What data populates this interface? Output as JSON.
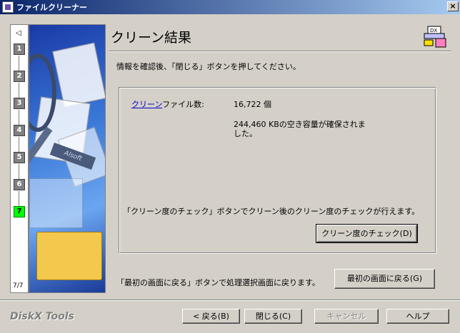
{
  "window": {
    "title": "ファイルクリーナー",
    "close_glyph": "×"
  },
  "steps": {
    "arrow": "◁",
    "items": [
      "1",
      "2",
      "3",
      "4",
      "5",
      "6",
      "7"
    ],
    "active": "7",
    "counter": "7/7"
  },
  "art": {
    "brush_text": "Alsoft"
  },
  "header": {
    "title": "クリーン結果",
    "logo_badge": "DX"
  },
  "instruction": "情報を確認後、「閉じる」ボタンを押してください。",
  "results": {
    "count_link": "クリーン",
    "count_label_rest": "ファイル数:",
    "count_value": "16,722 個",
    "freed_text": "244,460 KBの空き容量が確保されました。"
  },
  "check": {
    "description": "「クリーン度のチェック」ボタンでクリーン後のクリーン度のチェックが行えます。",
    "button": "クリーン度のチェック(D)"
  },
  "first": {
    "description": "「最初の画面に戻る」ボタンで処理選択画面に戻ります。",
    "button": "最初の画面に戻る(G)"
  },
  "footer": {
    "brand": "DiskX Tools",
    "back": "< 戻る(B)",
    "close": "閉じる(C)",
    "cancel": "キャンセル",
    "help": "ヘルプ"
  }
}
